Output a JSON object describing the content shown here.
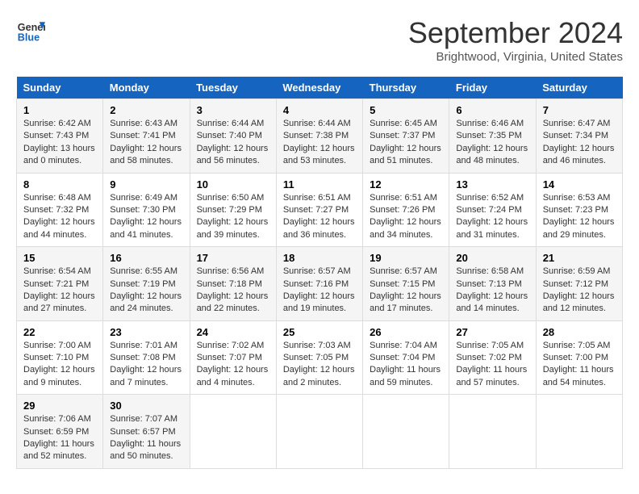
{
  "header": {
    "logo_text_general": "General",
    "logo_text_blue": "Blue",
    "month_title": "September 2024",
    "location": "Brightwood, Virginia, United States"
  },
  "calendar": {
    "weekdays": [
      "Sunday",
      "Monday",
      "Tuesday",
      "Wednesday",
      "Thursday",
      "Friday",
      "Saturday"
    ],
    "weeks": [
      [
        {
          "day": "1",
          "sunrise": "6:42 AM",
          "sunset": "7:43 PM",
          "daylight": "13 hours and 0 minutes."
        },
        {
          "day": "2",
          "sunrise": "6:43 AM",
          "sunset": "7:41 PM",
          "daylight": "12 hours and 58 minutes."
        },
        {
          "day": "3",
          "sunrise": "6:44 AM",
          "sunset": "7:40 PM",
          "daylight": "12 hours and 56 minutes."
        },
        {
          "day": "4",
          "sunrise": "6:44 AM",
          "sunset": "7:38 PM",
          "daylight": "12 hours and 53 minutes."
        },
        {
          "day": "5",
          "sunrise": "6:45 AM",
          "sunset": "7:37 PM",
          "daylight": "12 hours and 51 minutes."
        },
        {
          "day": "6",
          "sunrise": "6:46 AM",
          "sunset": "7:35 PM",
          "daylight": "12 hours and 48 minutes."
        },
        {
          "day": "7",
          "sunrise": "6:47 AM",
          "sunset": "7:34 PM",
          "daylight": "12 hours and 46 minutes."
        }
      ],
      [
        {
          "day": "8",
          "sunrise": "6:48 AM",
          "sunset": "7:32 PM",
          "daylight": "12 hours and 44 minutes."
        },
        {
          "day": "9",
          "sunrise": "6:49 AM",
          "sunset": "7:30 PM",
          "daylight": "12 hours and 41 minutes."
        },
        {
          "day": "10",
          "sunrise": "6:50 AM",
          "sunset": "7:29 PM",
          "daylight": "12 hours and 39 minutes."
        },
        {
          "day": "11",
          "sunrise": "6:51 AM",
          "sunset": "7:27 PM",
          "daylight": "12 hours and 36 minutes."
        },
        {
          "day": "12",
          "sunrise": "6:51 AM",
          "sunset": "7:26 PM",
          "daylight": "12 hours and 34 minutes."
        },
        {
          "day": "13",
          "sunrise": "6:52 AM",
          "sunset": "7:24 PM",
          "daylight": "12 hours and 31 minutes."
        },
        {
          "day": "14",
          "sunrise": "6:53 AM",
          "sunset": "7:23 PM",
          "daylight": "12 hours and 29 minutes."
        }
      ],
      [
        {
          "day": "15",
          "sunrise": "6:54 AM",
          "sunset": "7:21 PM",
          "daylight": "12 hours and 27 minutes."
        },
        {
          "day": "16",
          "sunrise": "6:55 AM",
          "sunset": "7:19 PM",
          "daylight": "12 hours and 24 minutes."
        },
        {
          "day": "17",
          "sunrise": "6:56 AM",
          "sunset": "7:18 PM",
          "daylight": "12 hours and 22 minutes."
        },
        {
          "day": "18",
          "sunrise": "6:57 AM",
          "sunset": "7:16 PM",
          "daylight": "12 hours and 19 minutes."
        },
        {
          "day": "19",
          "sunrise": "6:57 AM",
          "sunset": "7:15 PM",
          "daylight": "12 hours and 17 minutes."
        },
        {
          "day": "20",
          "sunrise": "6:58 AM",
          "sunset": "7:13 PM",
          "daylight": "12 hours and 14 minutes."
        },
        {
          "day": "21",
          "sunrise": "6:59 AM",
          "sunset": "7:12 PM",
          "daylight": "12 hours and 12 minutes."
        }
      ],
      [
        {
          "day": "22",
          "sunrise": "7:00 AM",
          "sunset": "7:10 PM",
          "daylight": "12 hours and 9 minutes."
        },
        {
          "day": "23",
          "sunrise": "7:01 AM",
          "sunset": "7:08 PM",
          "daylight": "12 hours and 7 minutes."
        },
        {
          "day": "24",
          "sunrise": "7:02 AM",
          "sunset": "7:07 PM",
          "daylight": "12 hours and 4 minutes."
        },
        {
          "day": "25",
          "sunrise": "7:03 AM",
          "sunset": "7:05 PM",
          "daylight": "12 hours and 2 minutes."
        },
        {
          "day": "26",
          "sunrise": "7:04 AM",
          "sunset": "7:04 PM",
          "daylight": "11 hours and 59 minutes."
        },
        {
          "day": "27",
          "sunrise": "7:05 AM",
          "sunset": "7:02 PM",
          "daylight": "11 hours and 57 minutes."
        },
        {
          "day": "28",
          "sunrise": "7:05 AM",
          "sunset": "7:00 PM",
          "daylight": "11 hours and 54 minutes."
        }
      ],
      [
        {
          "day": "29",
          "sunrise": "7:06 AM",
          "sunset": "6:59 PM",
          "daylight": "11 hours and 52 minutes."
        },
        {
          "day": "30",
          "sunrise": "7:07 AM",
          "sunset": "6:57 PM",
          "daylight": "11 hours and 50 minutes."
        },
        null,
        null,
        null,
        null,
        null
      ]
    ]
  }
}
